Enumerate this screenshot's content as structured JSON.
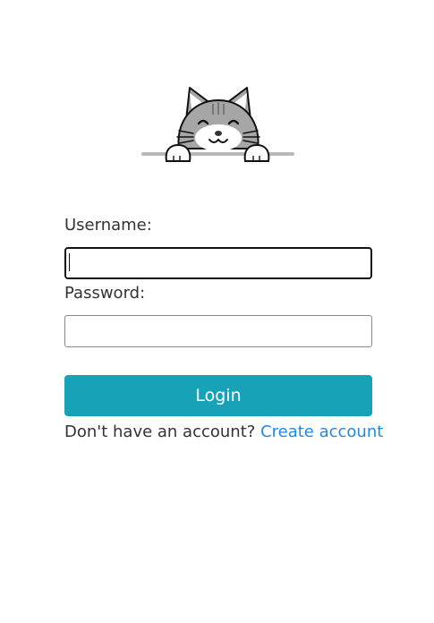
{
  "logo": {
    "icon": "cat-peeking-icon"
  },
  "form": {
    "username_label": "Username:",
    "username_value": "",
    "password_label": "Password:",
    "password_value": "",
    "login_button": "Login",
    "signup_prompt": "Don't have an account?",
    "signup_link": "Create account"
  },
  "colors": {
    "primary_button": "#17a2b8",
    "link": "#1e88e5",
    "text": "#333333"
  }
}
